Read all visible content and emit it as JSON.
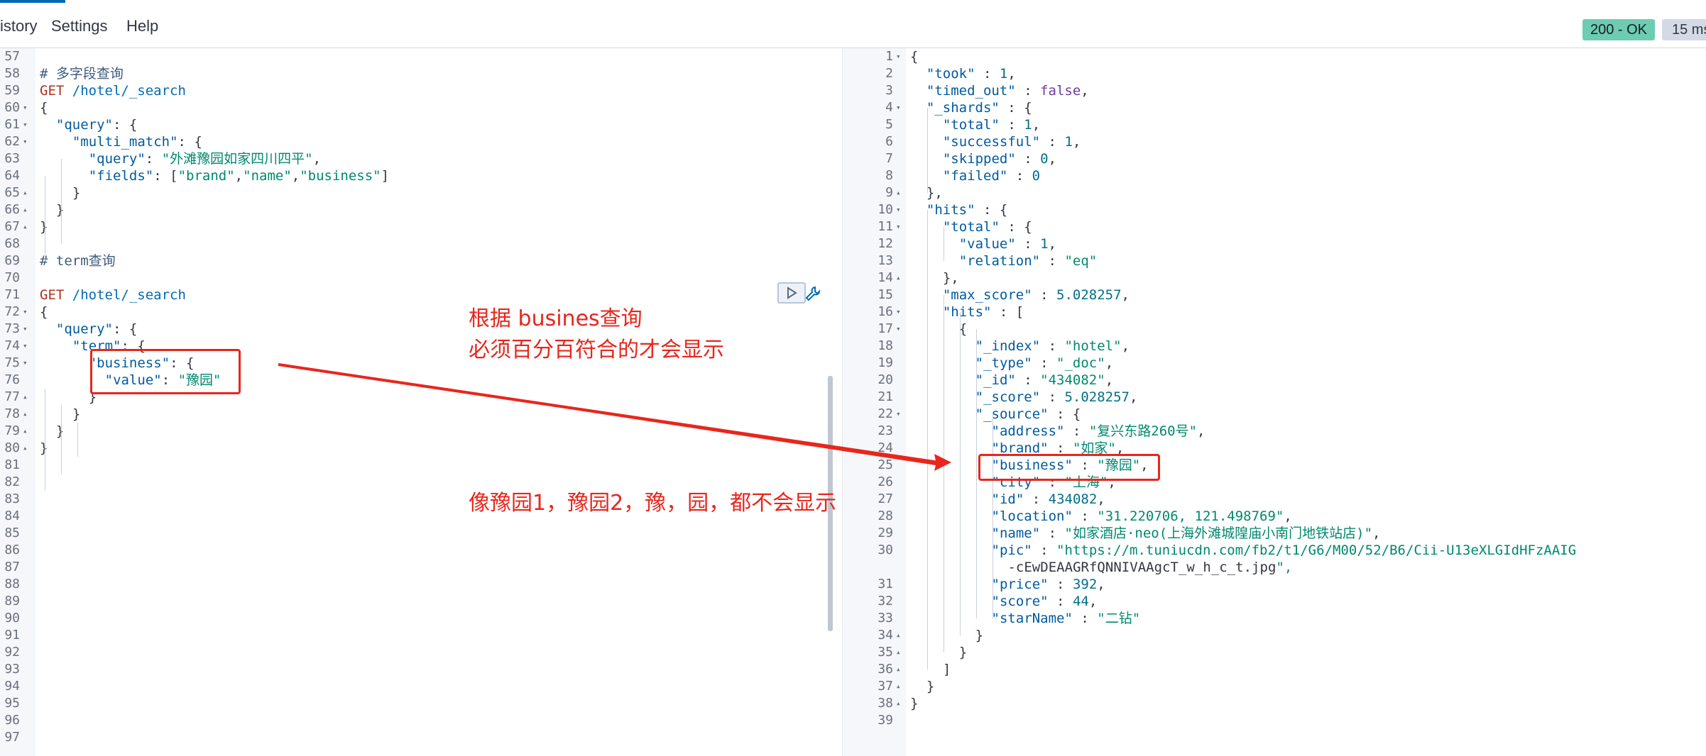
{
  "menu": {
    "history": "istory",
    "settings": "Settings",
    "help": "Help"
  },
  "status": {
    "code": "200 - OK",
    "time": "15 ms"
  },
  "colors": {
    "accent": "#006bb4",
    "status_ok": "#6dccb1",
    "annotation": "#e8261d"
  },
  "request_editor": {
    "lines": [
      {
        "n": "57",
        "fold": "",
        "code": ""
      },
      {
        "n": "58",
        "fold": "",
        "code": "# 多字段查询"
      },
      {
        "n": "59",
        "fold": "",
        "code": "GET /hotel/_search"
      },
      {
        "n": "60",
        "fold": "▾",
        "code": "{"
      },
      {
        "n": "61",
        "fold": "▾",
        "code": "  \"query\": {"
      },
      {
        "n": "62",
        "fold": "▾",
        "code": "    \"multi_match\": {"
      },
      {
        "n": "63",
        "fold": "",
        "code": "      \"query\": \"外滩豫园如家四川四平\","
      },
      {
        "n": "64",
        "fold": "",
        "code": "      \"fields\": [\"brand\",\"name\",\"business\"]"
      },
      {
        "n": "65",
        "fold": "▴",
        "code": "    }"
      },
      {
        "n": "66",
        "fold": "▴",
        "code": "  }"
      },
      {
        "n": "67",
        "fold": "▴",
        "code": "}"
      },
      {
        "n": "68",
        "fold": "",
        "code": ""
      },
      {
        "n": "69",
        "fold": "",
        "code": "# term查询"
      },
      {
        "n": "70",
        "fold": "",
        "code": ""
      },
      {
        "n": "71",
        "fold": "",
        "code": "GET /hotel/_search"
      },
      {
        "n": "72",
        "fold": "▾",
        "code": "{"
      },
      {
        "n": "73",
        "fold": "▾",
        "code": "  \"query\": {"
      },
      {
        "n": "74",
        "fold": "▾",
        "code": "    \"term\": {"
      },
      {
        "n": "75",
        "fold": "▾",
        "code": "      \"business\": {"
      },
      {
        "n": "76",
        "fold": "",
        "code": "        \"value\": \"豫园\""
      },
      {
        "n": "77",
        "fold": "▴",
        "code": "      }"
      },
      {
        "n": "78",
        "fold": "▴",
        "code": "    }"
      },
      {
        "n": "79",
        "fold": "▴",
        "code": "  }"
      },
      {
        "n": "80",
        "fold": "▴",
        "code": "}"
      },
      {
        "n": "81",
        "fold": "",
        "code": ""
      },
      {
        "n": "82",
        "fold": "",
        "code": ""
      },
      {
        "n": "83",
        "fold": "",
        "code": ""
      },
      {
        "n": "84",
        "fold": "",
        "code": ""
      },
      {
        "n": "85",
        "fold": "",
        "code": ""
      },
      {
        "n": "86",
        "fold": "",
        "code": ""
      },
      {
        "n": "87",
        "fold": "",
        "code": ""
      },
      {
        "n": "88",
        "fold": "",
        "code": ""
      },
      {
        "n": "89",
        "fold": "",
        "code": ""
      },
      {
        "n": "90",
        "fold": "",
        "code": ""
      },
      {
        "n": "91",
        "fold": "",
        "code": ""
      },
      {
        "n": "92",
        "fold": "",
        "code": ""
      },
      {
        "n": "93",
        "fold": "",
        "code": ""
      },
      {
        "n": "94",
        "fold": "",
        "code": ""
      },
      {
        "n": "95",
        "fold": "",
        "code": ""
      },
      {
        "n": "96",
        "fold": "",
        "code": ""
      },
      {
        "n": "97",
        "fold": "",
        "code": ""
      }
    ]
  },
  "response_editor": {
    "lines": [
      {
        "n": "1",
        "fold": "▾",
        "code": "{"
      },
      {
        "n": "2",
        "fold": "",
        "code": "  \"took\" : 1,"
      },
      {
        "n": "3",
        "fold": "",
        "code": "  \"timed_out\" : false,"
      },
      {
        "n": "4",
        "fold": "▾",
        "code": "  \"_shards\" : {"
      },
      {
        "n": "5",
        "fold": "",
        "code": "    \"total\" : 1,"
      },
      {
        "n": "6",
        "fold": "",
        "code": "    \"successful\" : 1,"
      },
      {
        "n": "7",
        "fold": "",
        "code": "    \"skipped\" : 0,"
      },
      {
        "n": "8",
        "fold": "",
        "code": "    \"failed\" : 0"
      },
      {
        "n": "9",
        "fold": "▴",
        "code": "  },"
      },
      {
        "n": "10",
        "fold": "▾",
        "code": "  \"hits\" : {"
      },
      {
        "n": "11",
        "fold": "▾",
        "code": "    \"total\" : {"
      },
      {
        "n": "12",
        "fold": "",
        "code": "      \"value\" : 1,"
      },
      {
        "n": "13",
        "fold": "",
        "code": "      \"relation\" : \"eq\""
      },
      {
        "n": "14",
        "fold": "▴",
        "code": "    },"
      },
      {
        "n": "15",
        "fold": "",
        "code": "    \"max_score\" : 5.028257,"
      },
      {
        "n": "16",
        "fold": "▾",
        "code": "    \"hits\" : ["
      },
      {
        "n": "17",
        "fold": "▾",
        "code": "      {"
      },
      {
        "n": "18",
        "fold": "",
        "code": "        \"_index\" : \"hotel\","
      },
      {
        "n": "19",
        "fold": "",
        "code": "        \"_type\" : \"_doc\","
      },
      {
        "n": "20",
        "fold": "",
        "code": "        \"_id\" : \"434082\","
      },
      {
        "n": "21",
        "fold": "",
        "code": "        \"_score\" : 5.028257,"
      },
      {
        "n": "22",
        "fold": "▾",
        "code": "        \"_source\" : {"
      },
      {
        "n": "23",
        "fold": "",
        "code": "          \"address\" : \"复兴东路260号\","
      },
      {
        "n": "24",
        "fold": "",
        "code": "          \"brand\" : \"如家\","
      },
      {
        "n": "25",
        "fold": "",
        "code": "          \"business\" : \"豫园\","
      },
      {
        "n": "26",
        "fold": "",
        "code": "          \"city\" : \"上海\","
      },
      {
        "n": "27",
        "fold": "",
        "code": "          \"id\" : 434082,"
      },
      {
        "n": "28",
        "fold": "",
        "code": "          \"location\" : \"31.220706, 121.498769\","
      },
      {
        "n": "29",
        "fold": "",
        "code": "          \"name\" : \"如家酒店·neo(上海外滩城隍庙小南门地铁站店)\","
      },
      {
        "n": "30",
        "fold": "",
        "code": "          \"pic\" : \"https://m.tuniucdn.com/fb2/t1/G6/M00/52/B6/Cii-U13eXLGIdHFzAAIG"
      },
      {
        "n": "",
        "fold": "",
        "code": "            -5cEwDEAAGRfQNNIV0AAgcT627_w200_h200_c1_t0.jpg\","
      },
      {
        "n": "31",
        "fold": "",
        "code": "          \"price\" : 392,"
      },
      {
        "n": "32",
        "fold": "",
        "code": "          \"score\" : 44,"
      },
      {
        "n": "33",
        "fold": "",
        "code": "          \"starName\" : \"二钻\""
      },
      {
        "n": "34",
        "fold": "▴",
        "code": "        }"
      },
      {
        "n": "35",
        "fold": "▴",
        "code": "      }"
      },
      {
        "n": "36",
        "fold": "▴",
        "code": "    ]"
      },
      {
        "n": "37",
        "fold": "▴",
        "code": "  }"
      },
      {
        "n": "38",
        "fold": "▴",
        "code": "}"
      },
      {
        "n": "39",
        "fold": "",
        "code": ""
      }
    ]
  },
  "annotations": {
    "note_title": "根据 busines查询",
    "note_rule": "必须百分百符合的才会显示",
    "note_example": "像豫园1，豫园2，豫，园，都不会显示"
  }
}
